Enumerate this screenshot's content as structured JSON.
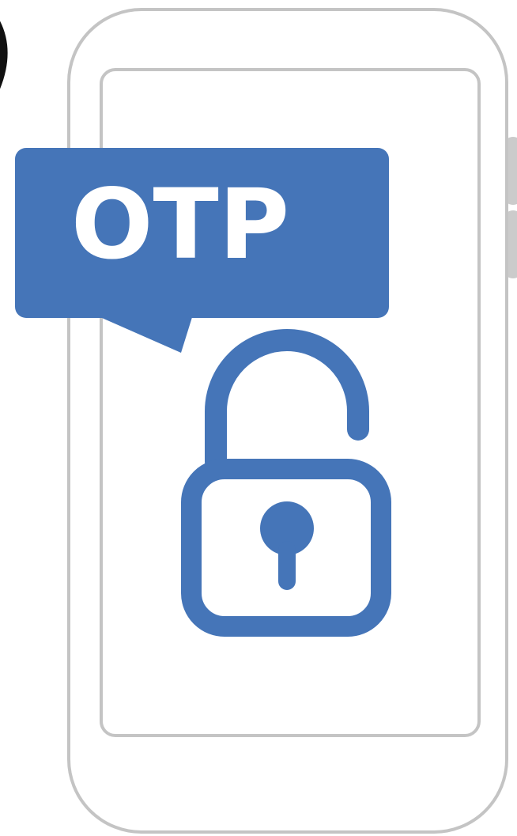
{
  "illustration": {
    "bubble_text": "OTP",
    "colors": {
      "accent": "#4575b8",
      "phone_outline": "#c4c4c4",
      "text_on_accent": "#ffffff",
      "background": "#ffffff"
    },
    "icons": {
      "phone": "smartphone-outline-icon",
      "lock": "unlocked-padlock-icon",
      "bubble": "speech-bubble-icon"
    }
  }
}
